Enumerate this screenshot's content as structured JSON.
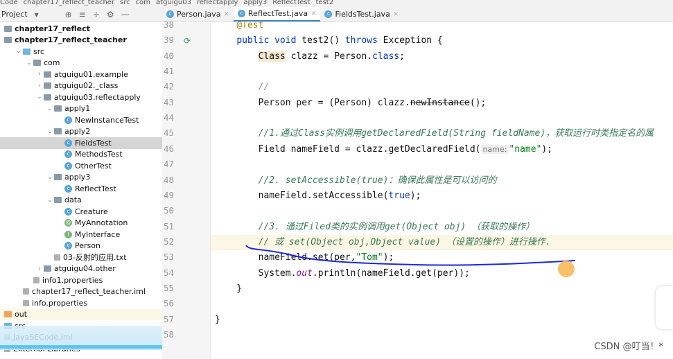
{
  "breadcrumb": [
    "Code",
    "chapter17_reflect_teacher",
    "src",
    "com",
    "atguigu03",
    "reflectapply",
    "apply3",
    "ReflectTest",
    "test2"
  ],
  "project_panel": {
    "title": "Project"
  },
  "tabs": [
    {
      "label": "Person.java",
      "active": false
    },
    {
      "label": "ReflectTest.java",
      "active": true
    },
    {
      "label": "FieldsTest.java",
      "active": false
    }
  ],
  "tree": [
    {
      "label": "chapter17_reflect",
      "depth": 0,
      "type": "module",
      "bold": true
    },
    {
      "label": "chapter17_reflect_teacher",
      "depth": 0,
      "type": "module",
      "bold": true
    },
    {
      "label": "src",
      "depth": 1,
      "type": "src",
      "arrow": "v"
    },
    {
      "label": "com",
      "depth": 2,
      "type": "pkg",
      "arrow": "v"
    },
    {
      "label": "atguigu01.example",
      "depth": 3,
      "type": "pkg",
      "arrow": ">"
    },
    {
      "label": "atguigu02._class",
      "depth": 3,
      "type": "pkg",
      "arrow": ">"
    },
    {
      "label": "atguigu03.reflectapply",
      "depth": 3,
      "type": "pkg",
      "arrow": "v"
    },
    {
      "label": "apply1",
      "depth": 4,
      "type": "pkg",
      "arrow": "v"
    },
    {
      "label": "NewInstanceTest",
      "depth": 5,
      "type": "cls"
    },
    {
      "label": "apply2",
      "depth": 4,
      "type": "pkg",
      "arrow": "v"
    },
    {
      "label": "FieldsTest",
      "depth": 5,
      "type": "cls",
      "selected": true
    },
    {
      "label": "MethodsTest",
      "depth": 5,
      "type": "cls"
    },
    {
      "label": "OtherTest",
      "depth": 5,
      "type": "cls"
    },
    {
      "label": "apply3",
      "depth": 4,
      "type": "pkg",
      "arrow": "v"
    },
    {
      "label": "ReflectTest",
      "depth": 5,
      "type": "cls"
    },
    {
      "label": "data",
      "depth": 4,
      "type": "pkg",
      "arrow": "v"
    },
    {
      "label": "Creature",
      "depth": 5,
      "type": "cls"
    },
    {
      "label": "MyAnnotation",
      "depth": 5,
      "type": "ann"
    },
    {
      "label": "MyInterface",
      "depth": 5,
      "type": "iface"
    },
    {
      "label": "Person",
      "depth": 5,
      "type": "cls"
    },
    {
      "label": "03-反射的应用.txt",
      "depth": 4,
      "type": "file"
    },
    {
      "label": "atguigu04.other",
      "depth": 3,
      "type": "pkg",
      "arrow": ">"
    },
    {
      "label": "info1.properties",
      "depth": 2,
      "type": "file"
    },
    {
      "label": "chapter17_reflect_teacher.iml",
      "depth": 1,
      "type": "file"
    },
    {
      "label": "info.properties",
      "depth": 1,
      "type": "file"
    },
    {
      "label": "out",
      "depth": 0,
      "type": "out"
    },
    {
      "label": "src",
      "depth": 0,
      "type": "src"
    },
    {
      "label": "JavaSECode.iml",
      "depth": 0,
      "type": "file"
    },
    {
      "label": "External Libraries",
      "depth": 0,
      "type": "lib"
    }
  ],
  "editor": {
    "current_line": 52,
    "lines": [
      {
        "n": "38",
        "t": [
          [
            "    "
          ],
          [
            "@Test",
            "ann"
          ]
        ]
      },
      {
        "n": "39",
        "t": [
          [
            "    "
          ],
          [
            "public void ",
            "kw"
          ],
          [
            "test2() "
          ],
          [
            "throws ",
            "kw"
          ],
          [
            "Exception {"
          ]
        ]
      },
      {
        "n": "40",
        "t": [
          [
            "        "
          ],
          [
            "Class",
            "clsbg"
          ],
          [
            " clazz = Person."
          ],
          [
            "class",
            "kw"
          ],
          [
            ";"
          ]
        ]
      },
      {
        "n": "41",
        "t": []
      },
      {
        "n": "42",
        "t": [
          [
            "        "
          ],
          [
            "//",
            "cm"
          ]
        ]
      },
      {
        "n": "43",
        "t": [
          [
            "        Person per = (Person) clazz."
          ],
          [
            "newInstance",
            "st"
          ],
          [
            "();"
          ]
        ]
      },
      {
        "n": "44",
        "t": []
      },
      {
        "n": "45",
        "t": [
          [
            "        "
          ],
          [
            "//1.通过Class实例调用getDeclaredField(String fieldName)，获取运行时类指定名的属",
            "cmg"
          ]
        ]
      },
      {
        "n": "46",
        "t": [
          [
            "        Field nameField = clazz.getDeclaredField("
          ],
          [
            "name:",
            "hint"
          ],
          [
            "\"name\"",
            "str"
          ],
          [
            ");"
          ]
        ]
      },
      {
        "n": "47",
        "t": []
      },
      {
        "n": "48",
        "t": [
          [
            "        "
          ],
          [
            "//2. setAccessible(true)：确保此属性是可以访问的",
            "cmg"
          ]
        ]
      },
      {
        "n": "49",
        "t": [
          [
            "        nameField.setAccessible("
          ],
          [
            "true",
            "kw"
          ],
          [
            ");"
          ]
        ]
      },
      {
        "n": "50",
        "t": []
      },
      {
        "n": "51",
        "t": [
          [
            "        "
          ],
          [
            "//3. 通过Filed类的实例调用get(Object obj) （获取的操作）",
            "cmg"
          ]
        ]
      },
      {
        "n": "52",
        "t": [
          [
            "        "
          ],
          [
            "// 或 set(Object obj,Object value) （设置的操作）进行操作.",
            "cmg"
          ]
        ]
      },
      {
        "n": "53",
        "t": [
          [
            "        nameField.set(per,"
          ],
          [
            "\"Tom\"",
            "str"
          ],
          [
            ");"
          ]
        ]
      },
      {
        "n": "54",
        "t": [
          [
            "        System."
          ],
          [
            "out",
            "fld"
          ],
          [
            ".println(nameField.get(per));"
          ]
        ]
      },
      {
        "n": "55",
        "t": [
          [
            "    }"
          ]
        ]
      },
      {
        "n": "56",
        "t": []
      },
      {
        "n": "57",
        "t": [
          [
            "}"
          ]
        ]
      },
      {
        "n": "58",
        "t": []
      }
    ]
  },
  "watermark": "CSDN @叮当！*",
  "colors": {
    "keyword": "#0033b3",
    "string": "#067d17",
    "comment": "#3a7a5a",
    "annotation_pen": "#1a2ad8",
    "tab_accent": "#4083c9"
  }
}
